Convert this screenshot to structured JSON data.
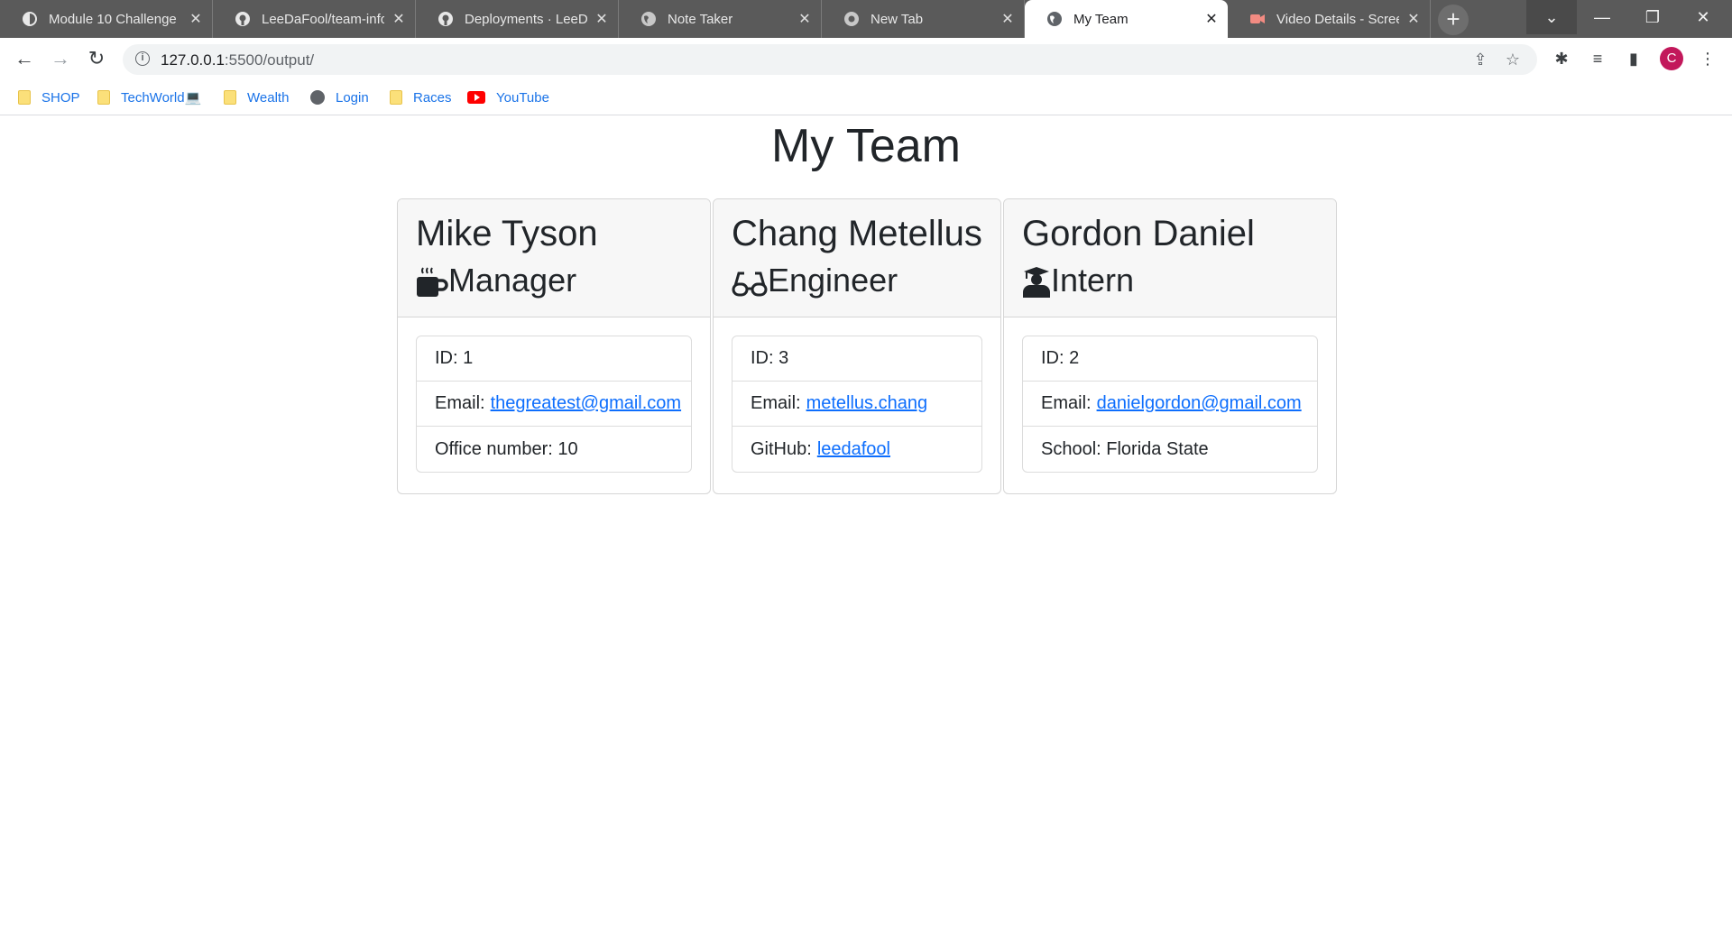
{
  "browser": {
    "tabs": [
      {
        "label": "Module 10 Challenge",
        "icon": "site-icon",
        "active": false
      },
      {
        "label": "LeeDaFool/team-info",
        "icon": "github-icon",
        "active": false
      },
      {
        "label": "Deployments · LeeDaF",
        "icon": "github-icon",
        "active": false
      },
      {
        "label": "Note Taker",
        "icon": "globe-icon",
        "active": false
      },
      {
        "label": "New Tab",
        "icon": "chrome-icon",
        "active": false
      },
      {
        "label": "My Team",
        "icon": "globe-icon",
        "active": true
      },
      {
        "label": "Video Details - Screen",
        "icon": "video-icon",
        "active": false
      }
    ],
    "url_host": "127.0.0.1",
    "url_rest": ":5500/output/",
    "profile_initial": "C",
    "bookmarks": [
      {
        "label": "SHOP",
        "icon": "folder-icon"
      },
      {
        "label": "TechWorld💻",
        "icon": "folder-icon"
      },
      {
        "label": "Wealth",
        "icon": "folder-icon"
      },
      {
        "label": "Login",
        "icon": "globe-icon"
      },
      {
        "label": "Races",
        "icon": "folder-icon"
      },
      {
        "label": "YouTube",
        "icon": "youtube-icon"
      }
    ]
  },
  "page": {
    "title": "My Team",
    "employees": [
      {
        "name": "Mike Tyson",
        "role": "Manager",
        "role_icon": "coffee-mug-icon",
        "id_text": "ID: 1",
        "email_label": "Email:",
        "email": "thegreatest@gmail.com",
        "extra_label": "Office number: 10",
        "extra_link": ""
      },
      {
        "name": "Chang Metellus",
        "role": "Engineer",
        "role_icon": "glasses-icon",
        "id_text": "ID: 3",
        "email_label": "Email:",
        "email": "metellus.chang",
        "extra_label": "GitHub:",
        "extra_link": "leedafool"
      },
      {
        "name": "Gordon Daniel",
        "role": "Intern",
        "role_icon": "graduate-icon",
        "id_text": "ID: 2",
        "email_label": "Email:",
        "email": "danielgordon@gmail.com",
        "extra_label": "School: Florida State",
        "extra_link": ""
      }
    ]
  },
  "colors": {
    "link": "#0d6efd",
    "card_header_bg": "#f7f7f7",
    "tabstrip_bg": "#5a5a5a",
    "profile_bg": "#c2185b"
  }
}
